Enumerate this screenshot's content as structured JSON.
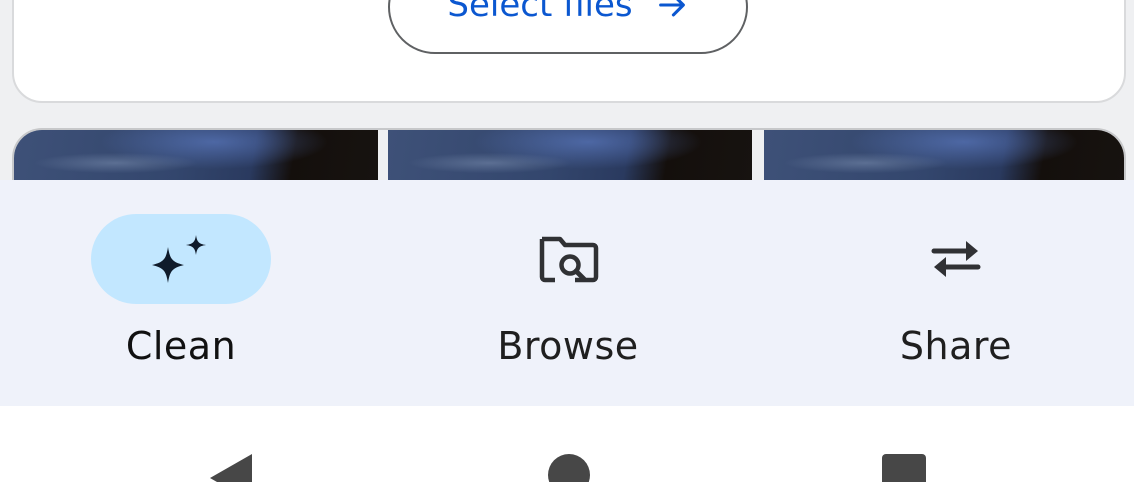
{
  "card": {
    "select_label": "Select files",
    "select_icon": "arrow-right-icon"
  },
  "thumbnails": [
    {
      "icon": "image-thumbnail"
    },
    {
      "icon": "image-thumbnail"
    },
    {
      "icon": "image-thumbnail"
    }
  ],
  "bottom_nav": {
    "items": [
      {
        "label": "Clean",
        "icon": "sparkle-icon",
        "active": true
      },
      {
        "label": "Browse",
        "icon": "folder-search-icon",
        "active": false
      },
      {
        "label": "Share",
        "icon": "swap-arrows-icon",
        "active": false
      }
    ],
    "active_color": "#c2e7ff",
    "background_color": "#eff2fa"
  },
  "system_nav": {
    "back": "back-icon",
    "home": "home-icon",
    "recents": "recents-icon"
  }
}
